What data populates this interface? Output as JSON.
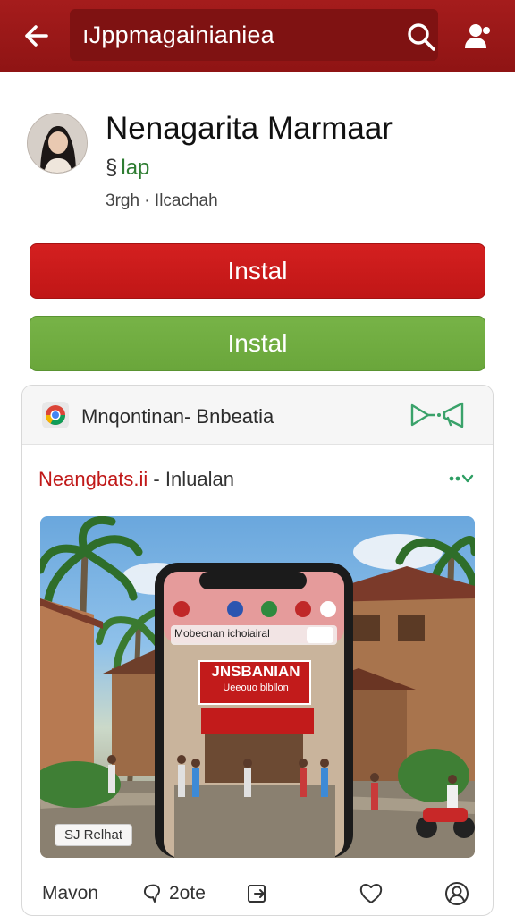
{
  "topbar": {
    "title": "ıJppmagainianiea",
    "back_icon": "back-arrow-icon",
    "search_icon": "search-icon",
    "user_icon": "user-icon",
    "color": "#9b1818"
  },
  "profile": {
    "name": "Nenagarita Marmaar",
    "handle_icon": "s-icon",
    "handle": "lap",
    "meta": "3rgh · Ilcachah"
  },
  "buttons": {
    "red_label": "Instal",
    "green_label": "Instal",
    "red_color": "#c81a1a",
    "green_color": "#70ac40"
  },
  "card": {
    "header_icon": "chrome-icon",
    "header_title": "Mnqontinan- Bnbeatia",
    "header_action_icon": "megaphone-icon",
    "post_author": "Neangbats.ii",
    "post_rest": " - Inlualan",
    "more_icon": "more-icon",
    "photo": {
      "phone_bar_text": "Mobecnan ichoiairal",
      "sign_title": "JNSBANIAN",
      "sign_sub": "Ueeouo blbllon",
      "badge": "SJ Relhat"
    },
    "actions": {
      "first": "Mavon",
      "second": "2ote",
      "third_icon": "share-icon",
      "fourth_icon": "heart-icon",
      "fifth_icon": "profile-icon"
    }
  }
}
